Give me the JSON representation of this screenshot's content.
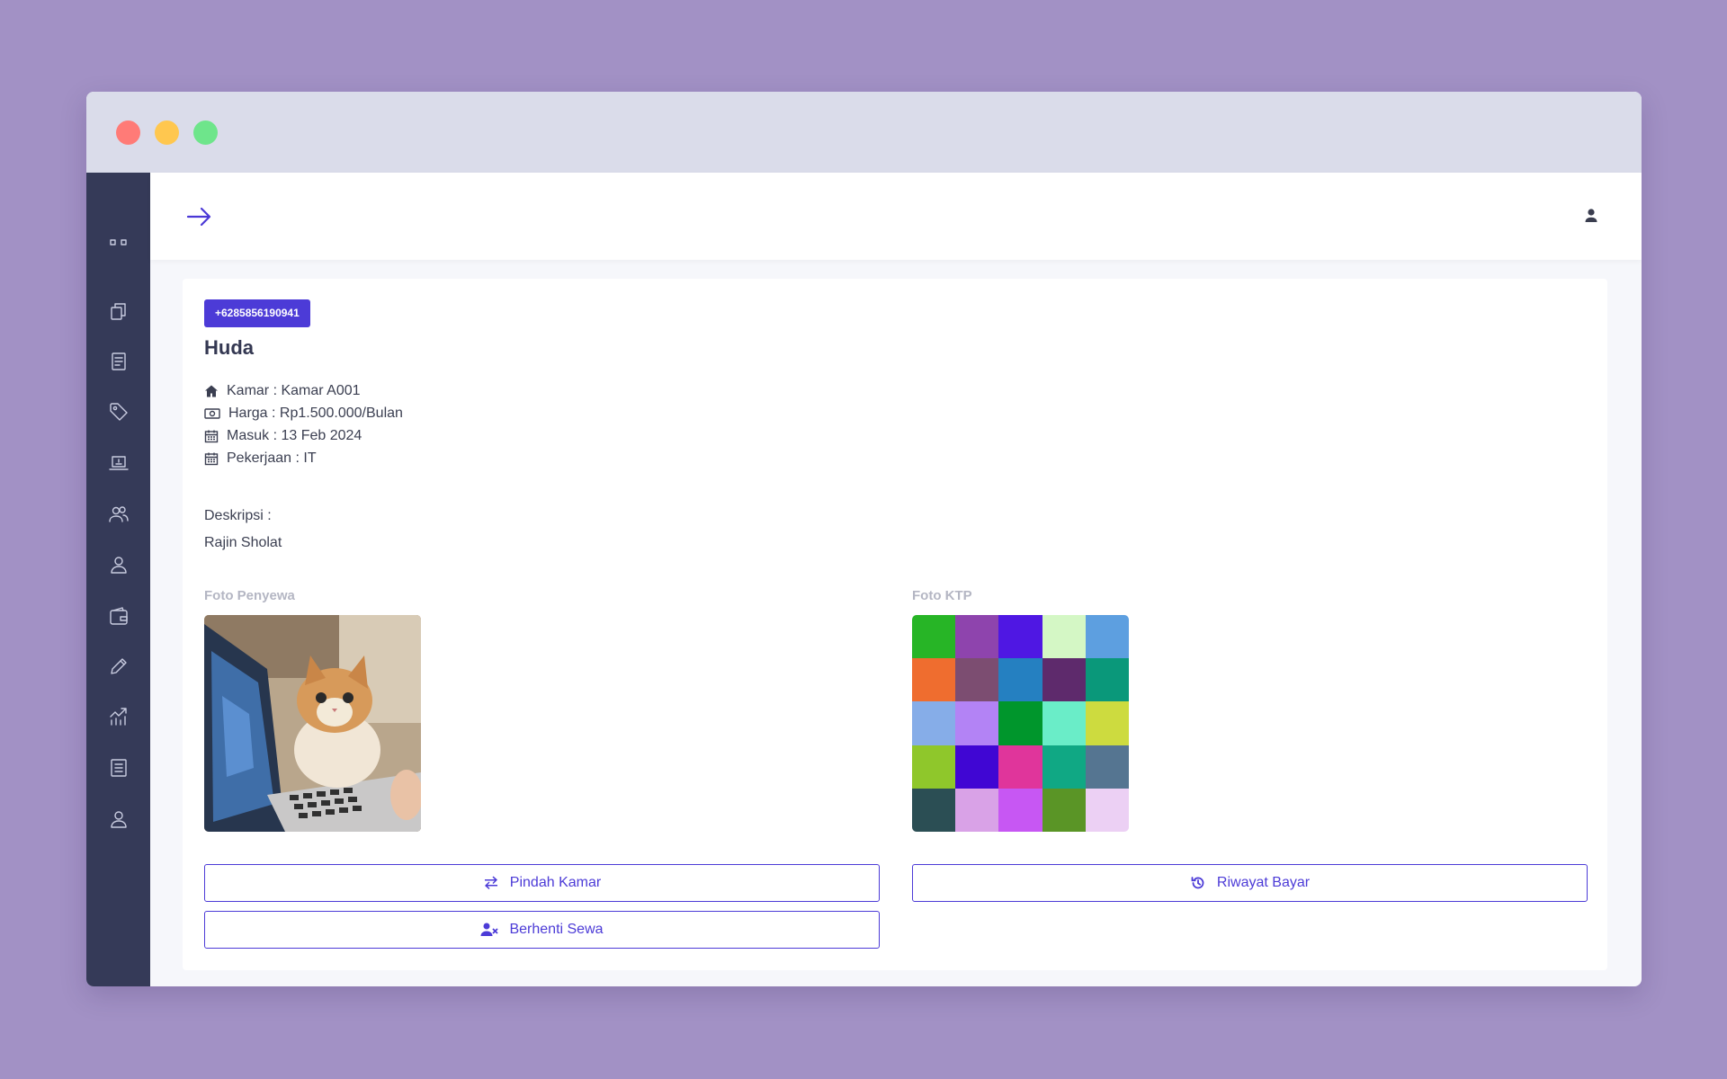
{
  "header": {
    "menu_icon": "arrow-right-icon",
    "user_icon": "user-icon"
  },
  "sidebar": {
    "items": [
      {
        "icon": "dashboard-icon"
      },
      {
        "icon": "copy-icon"
      },
      {
        "icon": "document-icon"
      },
      {
        "icon": "tag-icon"
      },
      {
        "icon": "laptop-icon"
      },
      {
        "icon": "users-icon"
      },
      {
        "icon": "user-icon"
      },
      {
        "icon": "wallet-icon"
      },
      {
        "icon": "pencil-icon"
      },
      {
        "icon": "chart-icon"
      },
      {
        "icon": "report-icon"
      },
      {
        "icon": "account-icon"
      }
    ]
  },
  "tenant": {
    "phone": "+6285856190941",
    "name": "Huda",
    "room": "Kamar : Kamar A001",
    "price": "Harga : Rp1.500.000/Bulan",
    "checkin": "Masuk : 13 Feb 2024",
    "job": "Pekerjaan : IT",
    "description_label": "Deskripsi :",
    "description": "Rajin Sholat",
    "photo_label": "Foto Penyewa",
    "ktp_label": "Foto KTP"
  },
  "ktp_colors": [
    "#27b526",
    "#8e44ad",
    "#4f17e3",
    "#d4f7c5",
    "#5d9fe0",
    "#ef6d2f",
    "#7c4d71",
    "#2580c1",
    "#5e2a6c",
    "#0a987a",
    "#86ade8",
    "#b383f5",
    "#00962c",
    "#6aedc8",
    "#cddb3f",
    "#8fc72b",
    "#4006d3",
    "#e0359b",
    "#10a884",
    "#557591",
    "#2b4e54",
    "#d9a2e7",
    "#c757f3",
    "#5a9526",
    "#ecd0f4"
  ],
  "actions": {
    "move": "Pindah Kamar",
    "history": "Riwayat Bayar",
    "stop": "Berhenti Sewa"
  }
}
